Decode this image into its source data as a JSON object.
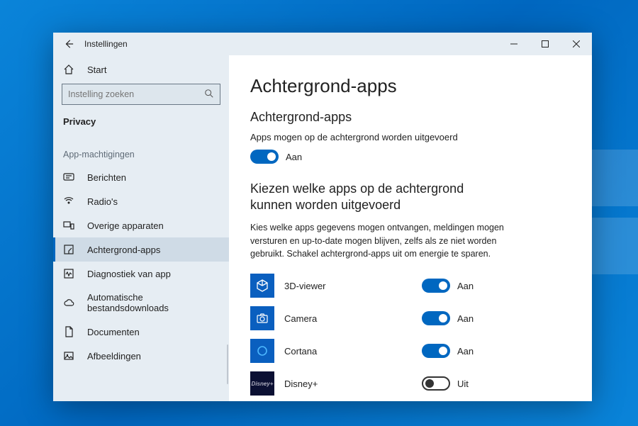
{
  "window": {
    "title": "Instellingen"
  },
  "sidebar": {
    "home_label": "Start",
    "search_placeholder": "Instelling zoeken",
    "category": "Privacy",
    "section_label": "App-machtigingen",
    "items": [
      {
        "label": "Berichten",
        "icon": "message"
      },
      {
        "label": "Radio's",
        "icon": "radio"
      },
      {
        "label": "Overige apparaten",
        "icon": "devices"
      },
      {
        "label": "Achtergrond-apps",
        "icon": "background",
        "selected": true
      },
      {
        "label": "Diagnostiek van app",
        "icon": "diagnostics"
      },
      {
        "label": "Automatische bestandsdownloads",
        "icon": "cloud"
      },
      {
        "label": "Documenten",
        "icon": "document"
      },
      {
        "label": "Afbeeldingen",
        "icon": "images"
      }
    ]
  },
  "content": {
    "page_title": "Achtergrond-apps",
    "section1_heading": "Achtergrond-apps",
    "global_toggle_desc": "Apps mogen op de achtergrond worden uitgevoerd",
    "global_toggle_state": "Aan",
    "section2_heading": "Kiezen welke apps op de achtergrond kunnen worden uitgevoerd",
    "helptext": "Kies welke apps gegevens mogen ontvangen, meldingen mogen versturen en up-to-date mogen blijven, zelfs als ze niet worden gebruikt. Schakel achtergrond-apps uit om energie te sparen.",
    "labels": {
      "on": "Aan",
      "off": "Uit"
    },
    "apps": [
      {
        "name": "3D-viewer",
        "state": "on",
        "icon": "cube"
      },
      {
        "name": "Camera",
        "state": "on",
        "icon": "camera"
      },
      {
        "name": "Cortana",
        "state": "on",
        "icon": "circle"
      },
      {
        "name": "Disney+",
        "state": "off",
        "icon": "disney"
      }
    ]
  }
}
